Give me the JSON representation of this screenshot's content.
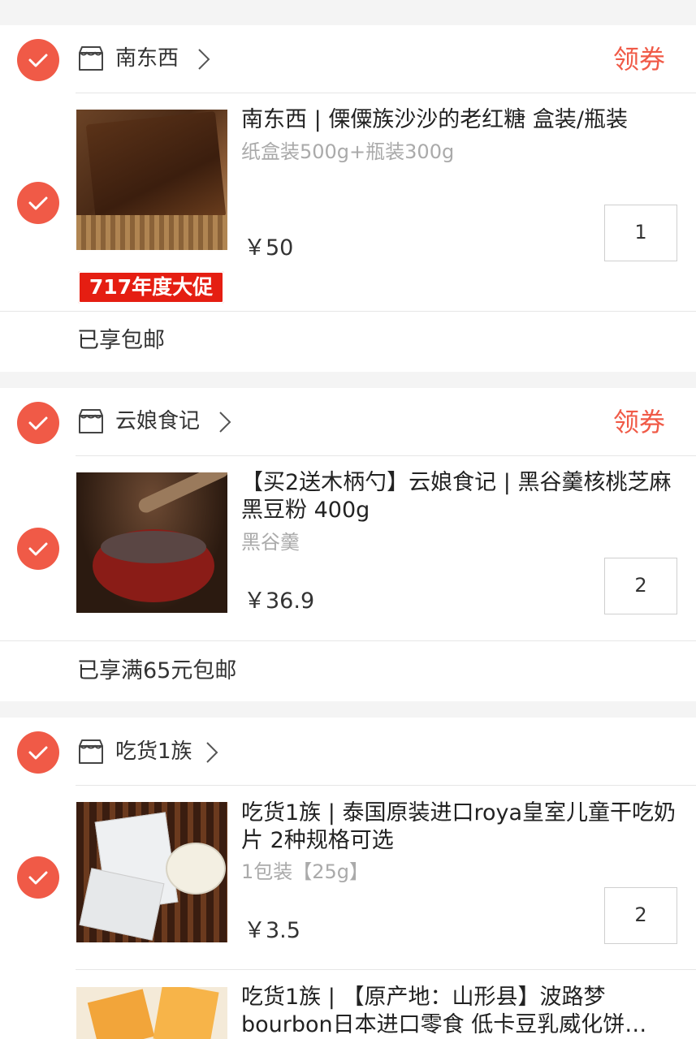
{
  "colors": {
    "accent": "#f05a47",
    "background": "#f4f4f4",
    "card": "#ffffff",
    "muted_text": "#aaaaaa"
  },
  "shops": [
    {
      "name": "南东西",
      "coupon_label": "领券",
      "shipping_note": "已享包邮",
      "items": [
        {
          "title": "南东西 | 傈僳族沙沙的老红糖 盒装/瓶装",
          "variant": "纸盒装500g+瓶装300g",
          "price": "￥50",
          "quantity": "1",
          "promo_badge": "717年度大促"
        }
      ]
    },
    {
      "name": "云娘食记",
      "coupon_label": "领券",
      "shipping_note": "已享满65元包邮",
      "items": [
        {
          "title": "【买2送木柄勺】云娘食记 | 黑谷羹核桃芝麻黑豆粉 400g",
          "variant": "黑谷羹",
          "price": "￥36.9",
          "quantity": "2"
        }
      ]
    },
    {
      "name": "吃货1族",
      "items": [
        {
          "title": "吃货1族 | 泰国原装进口roya皇室儿童干吃奶片 2种规格可选",
          "variant": "1包装【25g】",
          "price": "￥3.5",
          "quantity": "2"
        },
        {
          "title": "吃货1族 | 【原产地：山形县】波路梦bourbon日本进口零食 低卡豆乳威化饼…"
        }
      ]
    }
  ],
  "icons": {
    "check": "check-circle-icon",
    "store": "store-icon",
    "chevron": "chevron-right-icon"
  }
}
